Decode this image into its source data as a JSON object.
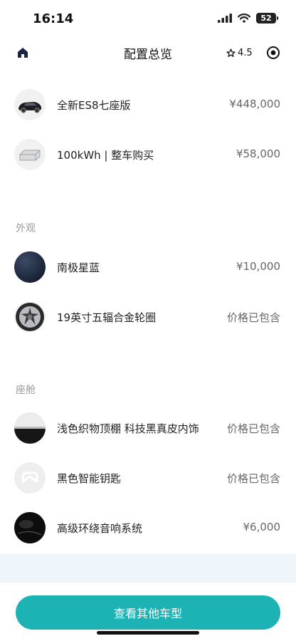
{
  "status_bar": {
    "time": "16:14",
    "battery": "52"
  },
  "nav": {
    "title": "配置总览",
    "rating": "4.5"
  },
  "sections": [
    {
      "label": "",
      "items": [
        {
          "name": "全新ES8七座版",
          "price": "¥448,000",
          "thumb": "car-icon"
        },
        {
          "name": "100kWh | 整车购买",
          "price": "¥58,000",
          "thumb": "battery-pack-icon"
        }
      ]
    },
    {
      "label": "外观",
      "items": [
        {
          "name": "南极星蓝",
          "price": "¥10,000",
          "thumb": "paint-swatch-icon"
        },
        {
          "name": "19英寸五辐合金轮圈",
          "price": "价格已包含",
          "thumb": "wheel-icon"
        }
      ]
    },
    {
      "label": "座舱",
      "items": [
        {
          "name": "浅色织物顶棚 科技黑真皮内饰",
          "price": "价格已包含",
          "thumb": "interior-swatch-icon"
        },
        {
          "name": "黑色智能钥匙",
          "price": "价格已包含",
          "thumb": "key-icon"
        },
        {
          "name": "高级环绕音响系统",
          "price": "¥6,000",
          "thumb": "speaker-icon"
        }
      ]
    }
  ],
  "cta": {
    "label": "查看其他车型"
  },
  "colors": {
    "accent": "#1db3b5",
    "paint": "#1e2a40"
  }
}
